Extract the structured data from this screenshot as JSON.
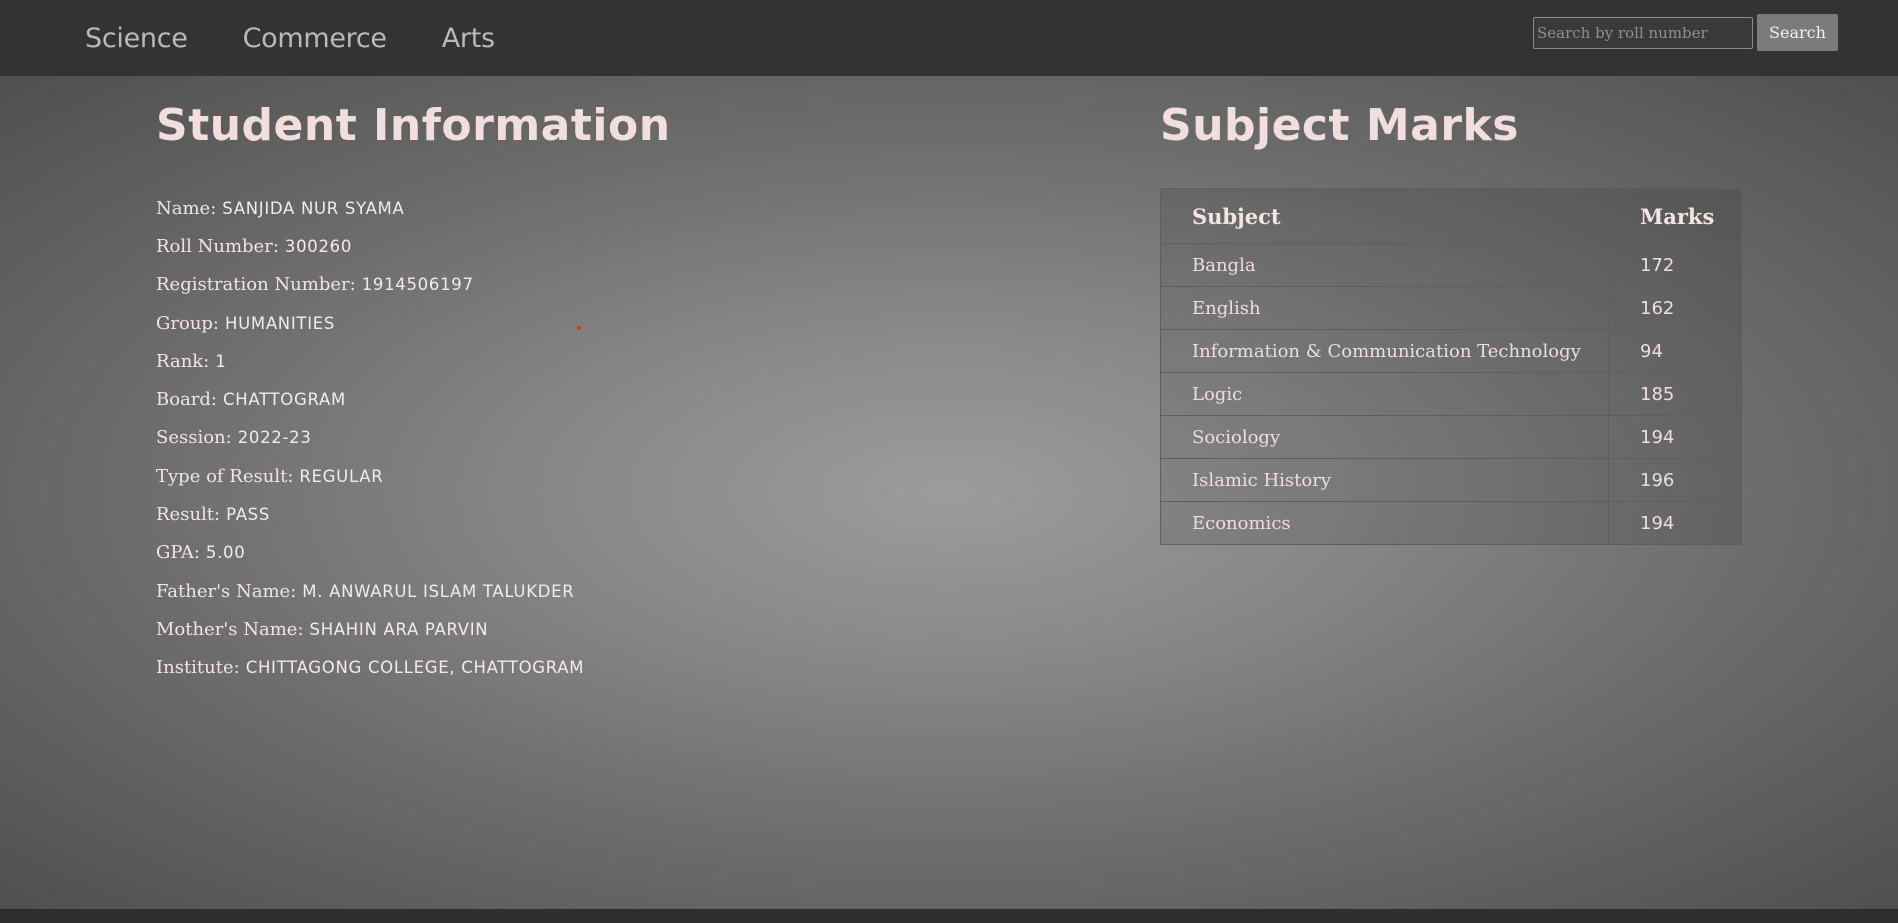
{
  "nav": {
    "links": [
      "Science",
      "Commerce",
      "Arts"
    ]
  },
  "search": {
    "placeholder": "Search by roll number",
    "value": "",
    "button_label": "Search"
  },
  "student_section": {
    "title": "Student Information",
    "fields": [
      {
        "label": "Name:",
        "value": "SANJIDA NUR SYAMA"
      },
      {
        "label": "Roll Number:",
        "value": "300260"
      },
      {
        "label": "Registration Number:",
        "value": "1914506197"
      },
      {
        "label": "Group:",
        "value": "HUMANITIES"
      },
      {
        "label": "Rank:",
        "value": "1"
      },
      {
        "label": "Board:",
        "value": "CHATTOGRAM"
      },
      {
        "label": "Session:",
        "value": "2022-23"
      },
      {
        "label": "Type of Result:",
        "value": "REGULAR"
      },
      {
        "label": "Result:",
        "value": "PASS"
      },
      {
        "label": "GPA:",
        "value": "5.00"
      },
      {
        "label": "Father's Name:",
        "value": "M. ANWARUL ISLAM TALUKDER"
      },
      {
        "label": "Mother's Name:",
        "value": "SHAHIN ARA PARVIN"
      },
      {
        "label": "Institute:",
        "value": "CHITTAGONG COLLEGE, CHATTOGRAM"
      }
    ]
  },
  "marks_section": {
    "title": "Subject Marks",
    "headers": [
      "Subject",
      "Marks"
    ],
    "rows": [
      [
        "Bangla",
        "172"
      ],
      [
        "English",
        "162"
      ],
      [
        "Information & Communication Technology",
        "94"
      ],
      [
        "Logic",
        "185"
      ],
      [
        "Sociology",
        "194"
      ],
      [
        "Islamic History",
        "196"
      ],
      [
        "Economics",
        "194"
      ]
    ]
  },
  "colors": {
    "navbar": "#333333",
    "heading": "#f2dede",
    "accent_dot": "#d9342a"
  }
}
